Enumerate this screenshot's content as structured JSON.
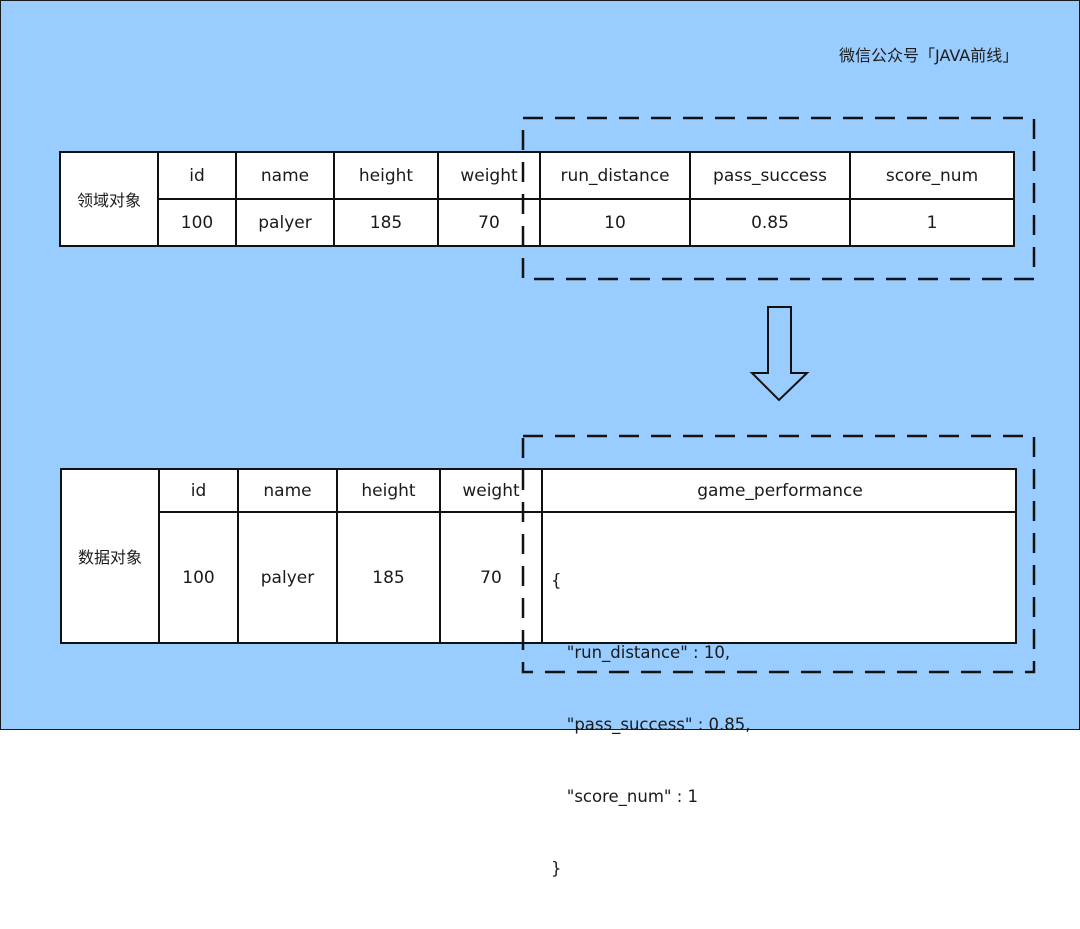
{
  "watermark": "微信公众号「JAVA前线」",
  "domain_table": {
    "label": "领域对象",
    "headers": [
      "id",
      "name",
      "height",
      "weight",
      "run_distance",
      "pass_success",
      "score_num"
    ],
    "values": [
      "100",
      "palyer",
      "185",
      "70",
      "10",
      "0.85",
      "1"
    ]
  },
  "data_table": {
    "label": "数据对象",
    "headers": [
      "id",
      "name",
      "height",
      "weight",
      "game_performance"
    ],
    "values": [
      "100",
      "palyer",
      "185",
      "70"
    ],
    "json_lines": [
      "{",
      "   \"run_distance\" : 10,",
      "   \"pass_success\" : 0.85,",
      "   \"score_num\" : 1",
      "}"
    ]
  },
  "colors": {
    "background": "#99ccff",
    "stroke": "#111111",
    "cell": "#ffffff"
  }
}
